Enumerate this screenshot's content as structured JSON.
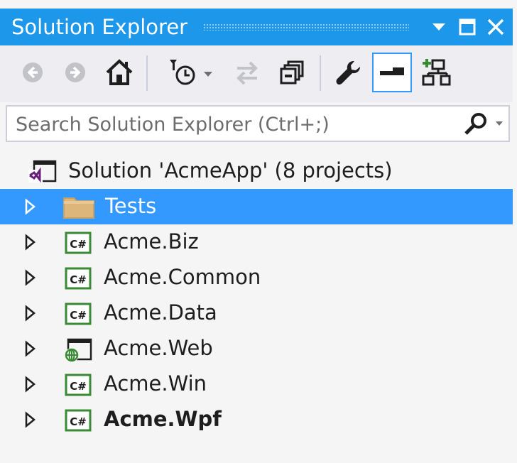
{
  "window": {
    "title": "Solution Explorer"
  },
  "colors": {
    "accent": "#1c97ea",
    "selection": "#3399ff",
    "active_tool_border": "#3399ff",
    "csharp_green": "#388a34",
    "vs_purple": "#68217a"
  },
  "toolbar": {
    "buttons": [
      {
        "name": "back",
        "icon": "back-arrow-icon"
      },
      {
        "name": "forward",
        "icon": "forward-arrow-icon"
      },
      {
        "name": "home",
        "icon": "home-icon"
      },
      {
        "name": "pending-changes-filter",
        "icon": "clock-filter-icon"
      },
      {
        "name": "sync-with-active-document",
        "icon": "sync-arrows-icon"
      },
      {
        "name": "collapse-all",
        "icon": "collapse-all-icon"
      },
      {
        "name": "properties",
        "icon": "wrench-icon"
      },
      {
        "name": "preview-selected-items",
        "icon": "preview-icon",
        "active": true
      },
      {
        "name": "view-class-diagram",
        "icon": "class-diagram-icon"
      }
    ]
  },
  "search": {
    "placeholder": "Search Solution Explorer (Ctrl+;)"
  },
  "tree": {
    "solution": {
      "label": "Solution 'AcmeApp' (8 projects)",
      "icon": "solution-icon"
    },
    "items": [
      {
        "label": "Tests",
        "icon": "folder-icon",
        "selected": true,
        "bold": false
      },
      {
        "label": "Acme.Biz",
        "icon": "csharp-project-icon",
        "selected": false,
        "bold": false
      },
      {
        "label": "Acme.Common",
        "icon": "csharp-project-icon",
        "selected": false,
        "bold": false
      },
      {
        "label": "Acme.Data",
        "icon": "csharp-project-icon",
        "selected": false,
        "bold": false
      },
      {
        "label": "Acme.Web",
        "icon": "web-project-icon",
        "selected": false,
        "bold": false
      },
      {
        "label": "Acme.Win",
        "icon": "csharp-project-icon",
        "selected": false,
        "bold": false
      },
      {
        "label": "Acme.Wpf",
        "icon": "csharp-project-icon",
        "selected": false,
        "bold": true
      }
    ]
  }
}
